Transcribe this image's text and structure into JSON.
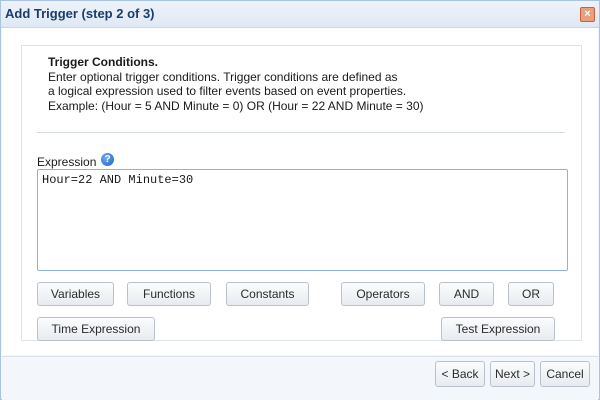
{
  "dialog": {
    "title": "Add Trigger (step 2 of 3)",
    "close_label": "×"
  },
  "info": {
    "heading": "Trigger Conditions.",
    "line1": "Enter optional trigger conditions. Trigger conditions are defined as",
    "line2": "a logical expression used to filter events based on event properties.",
    "line3": "Example: (Hour = 5 AND Minute = 0) OR (Hour = 22 AND Minute = 30)"
  },
  "expression": {
    "label": "Expression",
    "help_label": "?",
    "value": "Hour=22 AND Minute=30"
  },
  "toolbar": {
    "variables": "Variables",
    "functions": "Functions",
    "constants": "Constants",
    "operators": "Operators",
    "and": "AND",
    "or": "OR",
    "time_expression": "Time Expression",
    "test_expression": "Test Expression"
  },
  "footer": {
    "back": "< Back",
    "next": "Next >",
    "cancel": "Cancel"
  },
  "colors": {
    "title_text": "#1a3d6d",
    "border_accent": "#8fb2dc",
    "close_bg": "#e8a07f",
    "help_icon": "#1d62c9"
  }
}
